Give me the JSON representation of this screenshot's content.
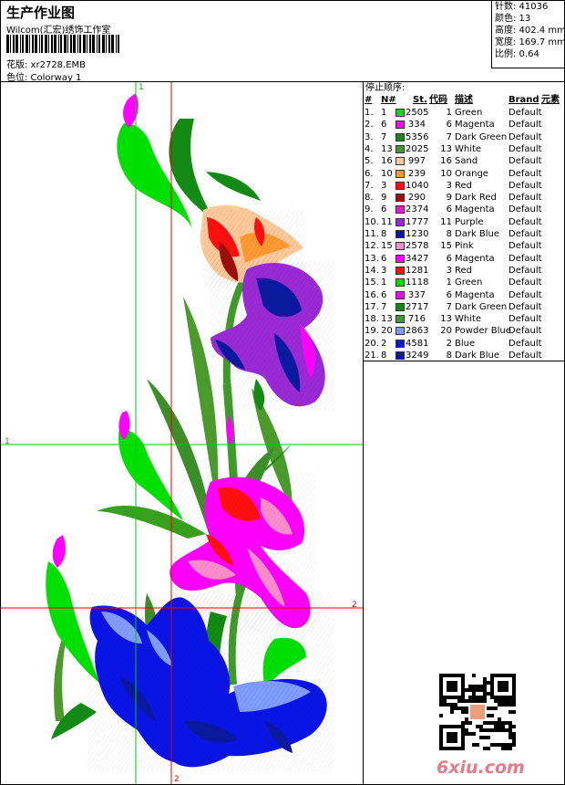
{
  "header": {
    "title": "生产作业图",
    "company": "Wilcom(汇宏)绣饰工作室",
    "design_name": "花版: xr2728.EMB",
    "colorway": "色位: Colorway 1"
  },
  "stats": {
    "stitches": "针数: 41036",
    "colors": "颜色: 13",
    "height": "高度: 402.4 mm",
    "width": "宽度: 169.7 mm",
    "scale": "比例: 0.64"
  },
  "sequence": {
    "title": "停止顺序:",
    "headers": [
      "#",
      "N#",
      "St.",
      "代码",
      "描述",
      "Brand",
      "元素"
    ],
    "rows": [
      {
        "idx": "1.",
        "n": "1",
        "color": "#00e000",
        "st": "2505",
        "code": "1",
        "desc": "Green",
        "brand": "Default"
      },
      {
        "idx": "2.",
        "n": "6",
        "color": "#ff00ff",
        "st": "334",
        "code": "6",
        "desc": "Magenta",
        "brand": "Default"
      },
      {
        "idx": "3.",
        "n": "7",
        "color": "#138a13",
        "st": "5356",
        "code": "7",
        "desc": "Dark Green",
        "brand": "Default"
      },
      {
        "idx": "4.",
        "n": "13",
        "color": "#3f9b2a",
        "st": "2025",
        "code": "13",
        "desc": "White",
        "brand": "Default"
      },
      {
        "idx": "5.",
        "n": "16",
        "color": "#ffc999",
        "st": "997",
        "code": "16",
        "desc": "Sand",
        "brand": "Default"
      },
      {
        "idx": "6.",
        "n": "10",
        "color": "#ff9a33",
        "st": "239",
        "code": "10",
        "desc": "Orange",
        "brand": "Default"
      },
      {
        "idx": "7.",
        "n": "3",
        "color": "#ff1010",
        "st": "1040",
        "code": "3",
        "desc": "Red",
        "brand": "Default"
      },
      {
        "idx": "8.",
        "n": "9",
        "color": "#a10c0c",
        "st": "290",
        "code": "9",
        "desc": "Dark Red",
        "brand": "Default"
      },
      {
        "idx": "9.",
        "n": "6",
        "color": "#ff00ff",
        "st": "2374",
        "code": "6",
        "desc": "Magenta",
        "brand": "Default"
      },
      {
        "idx": "10.",
        "n": "11",
        "color": "#9a2ad6",
        "st": "1777",
        "code": "11",
        "desc": "Purple",
        "brand": "Default"
      },
      {
        "idx": "11.",
        "n": "8",
        "color": "#0a1aa0",
        "st": "1230",
        "code": "8",
        "desc": "Dark Blue",
        "brand": "Default"
      },
      {
        "idx": "12.",
        "n": "15",
        "color": "#ff8ccc",
        "st": "2578",
        "code": "15",
        "desc": "Pink",
        "brand": "Default"
      },
      {
        "idx": "13.",
        "n": "6",
        "color": "#ff00ff",
        "st": "3427",
        "code": "6",
        "desc": "Magenta",
        "brand": "Default"
      },
      {
        "idx": "14.",
        "n": "3",
        "color": "#ff1010",
        "st": "1281",
        "code": "3",
        "desc": "Red",
        "brand": "Default"
      },
      {
        "idx": "15.",
        "n": "1",
        "color": "#00e000",
        "st": "1118",
        "code": "1",
        "desc": "Green",
        "brand": "Default"
      },
      {
        "idx": "16.",
        "n": "6",
        "color": "#ff00ff",
        "st": "337",
        "code": "6",
        "desc": "Magenta",
        "brand": "Default"
      },
      {
        "idx": "17.",
        "n": "7",
        "color": "#138a13",
        "st": "2717",
        "code": "7",
        "desc": "Dark Green",
        "brand": "Default"
      },
      {
        "idx": "18.",
        "n": "13",
        "color": "#3f9b2a",
        "st": "716",
        "code": "13",
        "desc": "White",
        "brand": "Default"
      },
      {
        "idx": "19.",
        "n": "20",
        "color": "#7f9cff",
        "st": "2863",
        "code": "20",
        "desc": "Powder Blue",
        "brand": "Default"
      },
      {
        "idx": "20.",
        "n": "2",
        "color": "#0a14e6",
        "st": "4581",
        "code": "2",
        "desc": "Blue",
        "brand": "Default"
      },
      {
        "idx": "21.",
        "n": "8",
        "color": "#0a1aa0",
        "st": "3249",
        "code": "8",
        "desc": "Dark Blue",
        "brand": "Default"
      }
    ]
  },
  "guides": {
    "label_1": "1",
    "label_2": "2"
  },
  "watermark": "6xiu.com",
  "colors": {
    "guide_green": "#00cc00",
    "guide_red": "#ee0000"
  }
}
